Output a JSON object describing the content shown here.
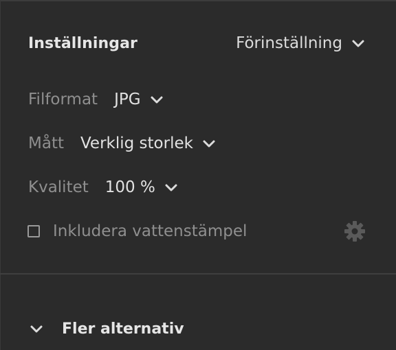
{
  "settings": {
    "title": "Inställningar",
    "preset_label": "Förinställning",
    "fields": [
      {
        "label": "Filformat",
        "value": "JPG"
      },
      {
        "label": "Mått",
        "value": "Verklig storlek"
      },
      {
        "label": "Kvalitet",
        "value": "100 %"
      }
    ],
    "watermark": {
      "label": "Inkludera vattenstämpel",
      "checked": false
    }
  },
  "more_options": {
    "label": "Fler alternativ",
    "expanded": false
  },
  "icons": {
    "dropdown": "chevron-down-icon",
    "settings": "gear-icon"
  },
  "colors": {
    "background": "#2b2b2b",
    "text_primary": "#e6e6e6",
    "text_secondary": "#8f8f8f",
    "divider": "#3f3f3f",
    "gear_disabled": "#5a5a5a"
  }
}
